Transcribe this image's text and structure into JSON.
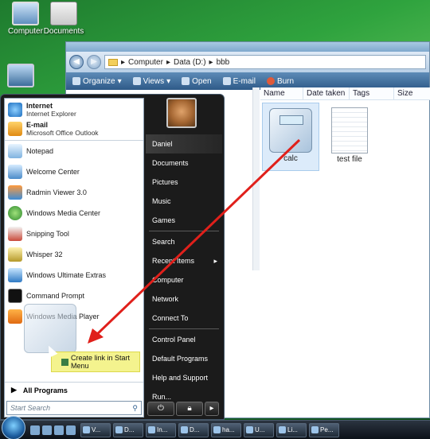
{
  "desktop": {
    "icons": [
      {
        "label": "Computer"
      },
      {
        "label": "Documents"
      },
      {
        "label": ""
      }
    ]
  },
  "explorer": {
    "breadcrumb": [
      "Computer",
      "Data (D:)",
      "bbb"
    ],
    "toolbar": {
      "organize": "Organize",
      "views": "Views",
      "open": "Open",
      "email": "E-mail",
      "burn": "Burn"
    },
    "columns": [
      "Name",
      "Date taken",
      "Tags",
      "Size"
    ],
    "files": [
      {
        "name": "calc",
        "icon": "calculator-icon",
        "selected": true
      },
      {
        "name": "test file",
        "icon": "text-file-icon",
        "selected": false
      }
    ]
  },
  "start_menu": {
    "pinned": [
      {
        "title": "Internet",
        "subtitle": "Internet Explorer",
        "icon": "internet-explorer-icon"
      },
      {
        "title": "E-mail",
        "subtitle": "Microsoft Office Outlook",
        "icon": "outlook-icon"
      }
    ],
    "recent": [
      {
        "label": "Notepad",
        "icon": "notepad-icon"
      },
      {
        "label": "Welcome Center",
        "icon": "welcome-center-icon"
      },
      {
        "label": "Radmin Viewer 3.0",
        "icon": "radmin-icon"
      },
      {
        "label": "Windows Media Center",
        "icon": "media-center-icon"
      },
      {
        "label": "Snipping Tool",
        "icon": "snipping-tool-icon"
      },
      {
        "label": "Whisper 32",
        "icon": "whisper-icon"
      },
      {
        "label": "Windows Ultimate Extras",
        "icon": "ultimate-extras-icon"
      },
      {
        "label": "Command Prompt",
        "icon": "command-prompt-icon"
      },
      {
        "label": "Windows Media Player",
        "icon": "media-player-icon"
      }
    ],
    "all_programs": "All Programs",
    "search_placeholder": "Start Search",
    "right": {
      "user": "Daniel",
      "items": [
        "Documents",
        "Pictures",
        "Music",
        "Games",
        "Search",
        "Recent Items",
        "Computer",
        "Network",
        "Connect To",
        "Control Panel",
        "Default Programs",
        "Help and Support",
        "Run..."
      ]
    }
  },
  "drag": {
    "tooltip": "Create link in Start Menu"
  },
  "taskbar": {
    "tasks": [
      "V...",
      "D...",
      "In...",
      "D...",
      "ha...",
      "U...",
      "Li...",
      "Pe..."
    ]
  },
  "colors": {
    "arrow": "#e0201b",
    "tooltip_bg": "#f4f38e",
    "start_menu_dark": "#1b1b1b"
  }
}
